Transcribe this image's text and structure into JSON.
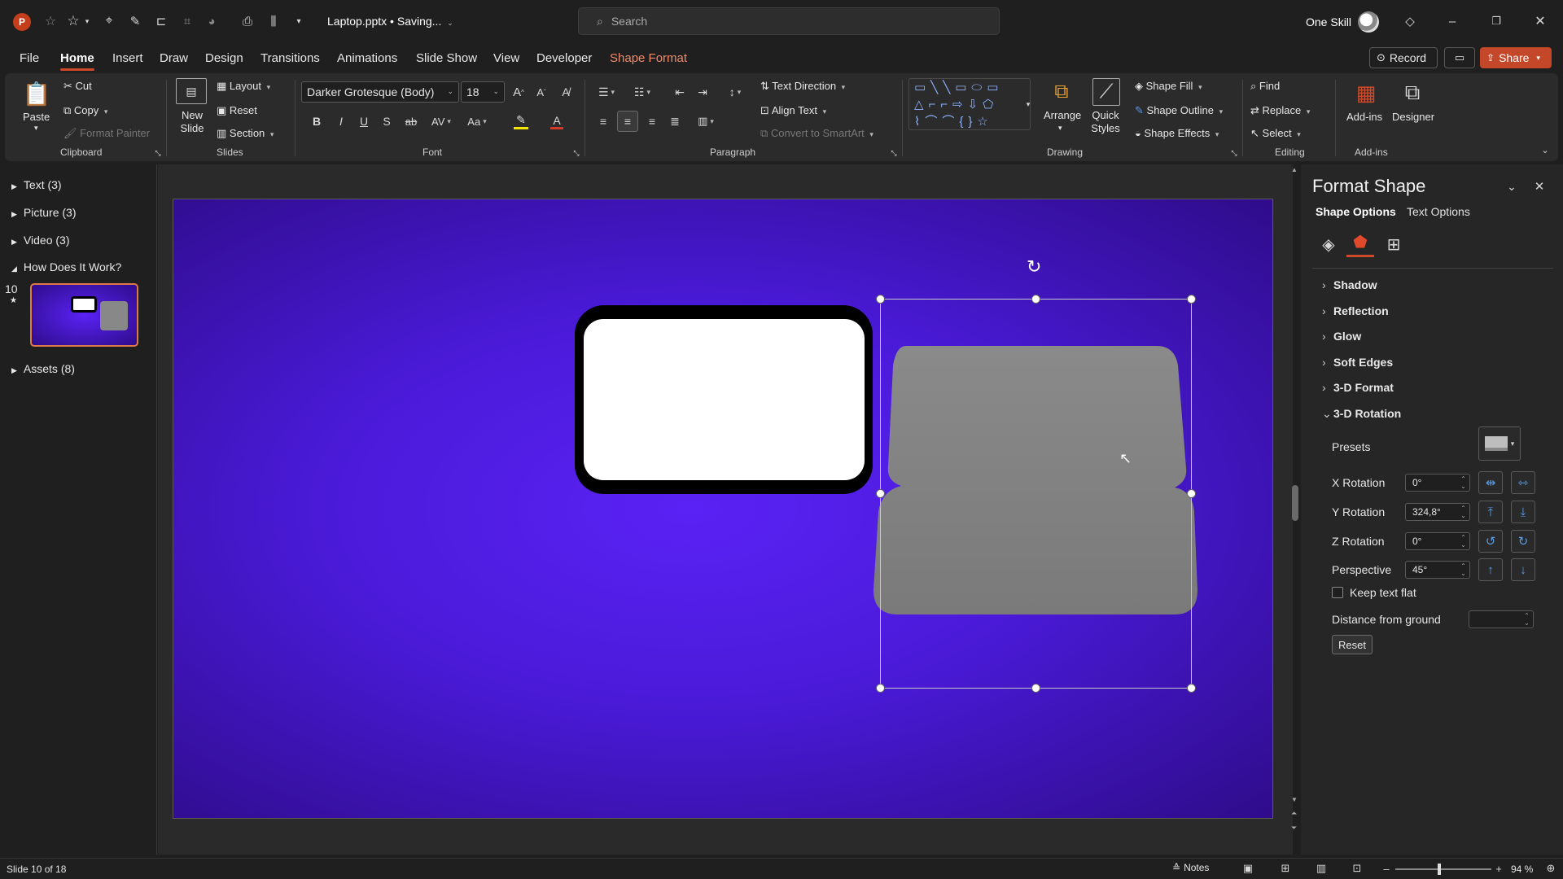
{
  "title_bar": {
    "app_badge": "P",
    "file_title": "Laptop.pptx • Saving...",
    "search_placeholder": "Search",
    "user_name": "One Skill"
  },
  "menu": {
    "tabs": [
      "File",
      "Home",
      "Insert",
      "Draw",
      "Design",
      "Transitions",
      "Animations",
      "Slide Show",
      "View",
      "Developer",
      "Shape Format"
    ],
    "active": "Home",
    "record_label": "Record",
    "share_label": "Share"
  },
  "ribbon": {
    "clipboard": {
      "paste": "Paste",
      "cut": "Cut",
      "copy": "Copy",
      "format_painter": "Format Painter",
      "label": "Clipboard"
    },
    "slides": {
      "new_slide": "New Slide",
      "layout": "Layout",
      "reset": "Reset",
      "section": "Section",
      "label": "Slides"
    },
    "font": {
      "font_name": "Darker Grotesque (Body)",
      "font_size": "18",
      "label": "Font"
    },
    "paragraph": {
      "text_direction": "Text Direction",
      "align_text": "Align Text",
      "convert_smartart": "Convert to SmartArt",
      "label": "Paragraph"
    },
    "drawing": {
      "arrange": "Arrange",
      "quick_styles": "Quick Styles",
      "shape_fill": "Shape Fill",
      "shape_outline": "Shape Outline",
      "shape_effects": "Shape Effects",
      "label": "Drawing"
    },
    "editing": {
      "find": "Find",
      "replace": "Replace",
      "select": "Select",
      "label": "Editing"
    },
    "addins": {
      "addins": "Add-ins",
      "designer": "Designer",
      "label": "Add-ins"
    }
  },
  "left_panel": {
    "sections": [
      {
        "label": "Text (3)",
        "expanded": false
      },
      {
        "label": "Picture (3)",
        "expanded": false
      },
      {
        "label": "Video (3)",
        "expanded": false
      },
      {
        "label": "How Does It Work?",
        "expanded": true
      },
      {
        "label": "Assets (8)",
        "expanded": false
      }
    ],
    "slide_number": "10",
    "slide_star": "★"
  },
  "format_pane": {
    "title": "Format Shape",
    "tab_shape": "Shape Options",
    "tab_text": "Text Options",
    "collapsed_items": [
      "Shadow",
      "Reflection",
      "Glow",
      "Soft Edges",
      "3-D Format"
    ],
    "expanded_item": "3-D Rotation",
    "presets_label": "Presets",
    "x_rotation_label": "X Rotation",
    "x_rotation_value": "0°",
    "y_rotation_label": "Y Rotation",
    "y_rotation_value": "324,8°",
    "z_rotation_label": "Z Rotation",
    "z_rotation_value": "0°",
    "perspective_label": "Perspective",
    "perspective_value": "45°",
    "keep_text_flat": "Keep text flat",
    "distance_label": "Distance from ground",
    "distance_value": "",
    "reset_label": "Reset"
  },
  "status": {
    "slide_info": "Slide 10 of 18",
    "notes": "Notes",
    "zoom": "94 %"
  },
  "colors": {
    "accent": "#d04a2a",
    "slide_center": "#5a22f5",
    "slide_edge": "#2e0c8a",
    "gray_shape": "#808080"
  }
}
